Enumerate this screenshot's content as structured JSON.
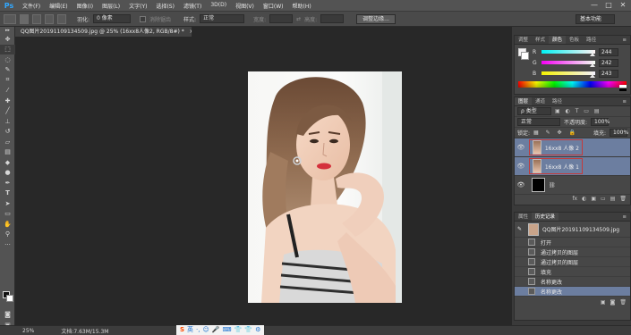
{
  "app": {
    "logo": "Ps"
  },
  "menu": [
    "文件(F)",
    "编辑(E)",
    "图像(I)",
    "图层(L)",
    "文字(Y)",
    "选择(S)",
    "滤镜(T)",
    "3D(D)",
    "视图(V)",
    "窗口(W)",
    "帮助(H)"
  ],
  "window_controls": [
    "—",
    "□",
    "✕"
  ],
  "options": {
    "feather_label": "羽化:",
    "feather_value": "0 像素",
    "antialias_label": "消除锯齿",
    "style_label": "样式:",
    "style_value": "正常",
    "width_label": "宽度:",
    "height_label": "高度:",
    "refine_edge": "调整边缘...",
    "workspace": "基本功能"
  },
  "document": {
    "tab_title": "QQ图片20191109134509.jpg @ 25% (16xx8人像2, RGB/8#) *"
  },
  "status": {
    "zoom": "25%",
    "doc_info": "文档:7.63M/15.3M"
  },
  "ime": [
    "S",
    "英",
    "·,",
    "☺",
    "🎤",
    "⌨",
    "👕",
    "👕",
    "⚙"
  ],
  "color_panel": {
    "tabs": [
      "调整",
      "样式",
      "颜色",
      "色板",
      "路径"
    ],
    "active_tab": "颜色",
    "channels": [
      {
        "label": "R",
        "value": "244",
        "fraction": 0.957,
        "gradient": "linear-gradient(to right,#00f2f3,#fff2f3)"
      },
      {
        "label": "G",
        "value": "242",
        "fraction": 0.949,
        "gradient": "linear-gradient(to right,#f400f3,#f4fff3)"
      },
      {
        "label": "B",
        "value": "243",
        "fraction": 0.953,
        "gradient": "linear-gradient(to right,#f4f200,#f4f2ff)"
      }
    ],
    "foreground": "#f4f2f3"
  },
  "layers_panel": {
    "tabs": [
      "图层",
      "通道",
      "路径"
    ],
    "active_tab": "图层",
    "kind_label": "ρ 类型",
    "blend_mode": "正常",
    "opacity_label": "不透明度:",
    "opacity": "100%",
    "lock_label": "锁定:",
    "fill_label": "填充:",
    "fill": "100%",
    "layers": [
      {
        "name": "16xx8 人像 2",
        "selected": true,
        "thumb": "photo"
      },
      {
        "name": "16xx8 人像 1",
        "selected": true,
        "thumb": "photo"
      },
      {
        "name": "",
        "selected": false,
        "thumb": "black"
      }
    ],
    "footer_icons": [
      "fx",
      "◐",
      "▣",
      "▭",
      "▤",
      "🗑"
    ]
  },
  "history_panel": {
    "tabs": [
      "属性",
      "历史记录"
    ],
    "active_tab": "历史记录",
    "source": "QQ图片20191109134509.jpg",
    "items": [
      {
        "label": "打开",
        "active": false
      },
      {
        "label": "通过拷贝的图层",
        "active": false
      },
      {
        "label": "通过拷贝的图层",
        "active": false
      },
      {
        "label": "填充",
        "active": false
      },
      {
        "label": "名称更改",
        "active": false
      },
      {
        "label": "名称更改",
        "active": true
      }
    ]
  }
}
